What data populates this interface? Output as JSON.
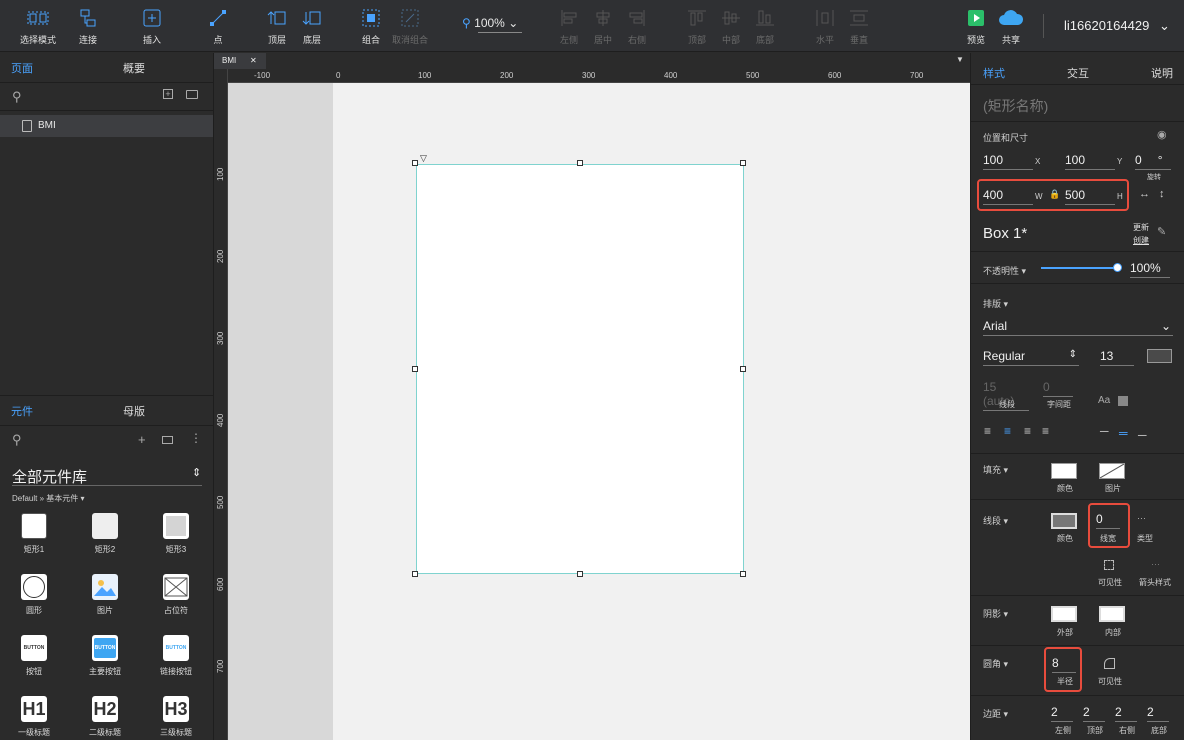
{
  "toolbar": {
    "select_mode": "选择模式",
    "connect": "连接",
    "insert": "插入",
    "point": "点",
    "top_layer": "顶层",
    "bottom_layer": "底层",
    "group": "组合",
    "ungroup": "取消组合",
    "zoom": "100%",
    "align_left": "左侧",
    "align_center": "居中",
    "align_right": "右侧",
    "align_top": "顶部",
    "align_middle": "中部",
    "align_bottom": "底部",
    "distribute_h": "水平",
    "distribute_v": "垂直",
    "preview": "预览",
    "share": "共享",
    "username": "li16620164429"
  },
  "left": {
    "tab_pages": "页面",
    "tab_outline": "概要",
    "page_name": "BMI",
    "tab_widgets": "元件",
    "tab_masters": "母版",
    "library": "全部元件库",
    "library_sub": "Default » 基本元件",
    "widgets": [
      {
        "label": "矩形1"
      },
      {
        "label": "矩形2"
      },
      {
        "label": "矩形3"
      },
      {
        "label": "圆形"
      },
      {
        "label": "图片"
      },
      {
        "label": "占位符"
      },
      {
        "label": "按钮"
      },
      {
        "label": "主要按钮"
      },
      {
        "label": "链接按钮"
      },
      {
        "label": "一级标题"
      },
      {
        "label": "二级标题"
      },
      {
        "label": "三级标题"
      }
    ],
    "button_text": "BUTTON",
    "h1": "H1",
    "h2": "H2",
    "h3": "H3"
  },
  "canvas": {
    "doc_tab": "BMI",
    "ruler_h": [
      "-100",
      "0",
      "100",
      "200",
      "300",
      "400",
      "500",
      "600",
      "700"
    ],
    "ruler_v": [
      "100",
      "200",
      "300",
      "400",
      "500",
      "600",
      "700"
    ]
  },
  "right": {
    "tab_style": "样式",
    "tab_interact": "交互",
    "tab_notes": "说明",
    "shape_name": "(矩形名称)",
    "pos_size": "位置和尺寸",
    "x": "100",
    "x_label": "X",
    "y": "100",
    "y_label": "Y",
    "rotation": "0",
    "rotation_unit": "°",
    "rotation_label": "旋转",
    "w": "400",
    "w_label": "W",
    "h": "500",
    "h_label": "H",
    "style_name": "Box 1*",
    "update": "更新",
    "create": "创建",
    "opacity_label": "不透明性",
    "opacity": "100%",
    "typography": "排版",
    "font": "Arial",
    "weight": "Regular",
    "font_size": "13",
    "line_spacing": "15 (auto)",
    "char_spacing": "0",
    "line_label": "线段",
    "char_label": "字间距",
    "fill": "填充",
    "fill_color": "颜色",
    "fill_image": "图片",
    "stroke": "线段",
    "stroke_color": "颜色",
    "stroke_width": "0",
    "stroke_width_label": "线宽",
    "stroke_type": "类型",
    "visibility": "可见性",
    "arrow_style": "箭头样式",
    "shadow": "阴影",
    "shadow_outer": "外部",
    "shadow_inner": "内部",
    "corner": "圆角",
    "radius": "8",
    "radius_label": "半径",
    "corner_vis": "可见性",
    "padding": "边距",
    "pad_left": "2",
    "pad_top": "2",
    "pad_right": "2",
    "pad_bottom": "2",
    "pad_left_label": "左侧",
    "pad_top_label": "顶部",
    "pad_right_label": "右侧",
    "pad_bottom_label": "底部"
  }
}
